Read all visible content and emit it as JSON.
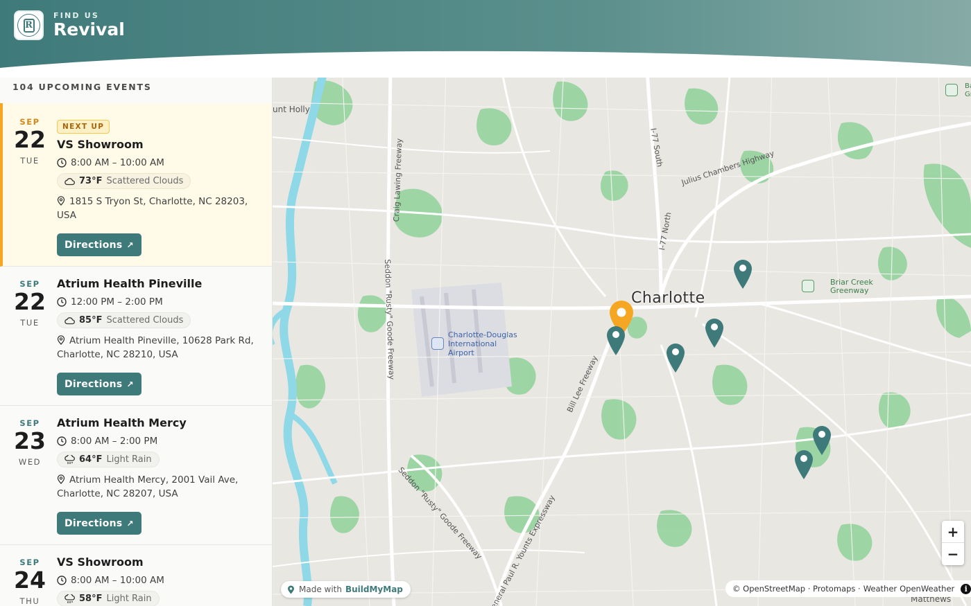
{
  "header": {
    "eyebrow": "FIND US",
    "brand": "Revival",
    "logo_icon": "revival-logo",
    "colors": {
      "primary": "#3f7a7a",
      "accent": "#f5a623"
    }
  },
  "sidebar": {
    "count_label": "104 UPCOMING EVENTS",
    "next_badge": "NEXT UP",
    "directions_label": "Directions",
    "events": [
      {
        "month": "SEP",
        "day": "22",
        "dow": "TUE",
        "title": "VS Showroom",
        "time": "8:00 AM – 10:00 AM",
        "temp": "73°F",
        "condition": "Scattered Clouds",
        "weather_icon": "cloud-icon",
        "address": "1815 S Tryon St, Charlotte, NC 28203, USA",
        "next": true
      },
      {
        "month": "SEP",
        "day": "22",
        "dow": "TUE",
        "title": "Atrium Health Pineville",
        "time": "12:00 PM – 2:00 PM",
        "temp": "85°F",
        "condition": "Scattered Clouds",
        "weather_icon": "cloud-icon",
        "address": "Atrium Health Pineville, 10628 Park Rd, Charlotte, NC 28210, USA",
        "next": false
      },
      {
        "month": "SEP",
        "day": "23",
        "dow": "WED",
        "title": "Atrium Health Mercy",
        "time": "8:00 AM – 2:00 PM",
        "temp": "64°F",
        "condition": "Light Rain",
        "weather_icon": "rain-icon",
        "address": "Atrium Health Mercy, 2001 Vail Ave, Charlotte, NC 28207, USA",
        "next": false
      },
      {
        "month": "SEP",
        "day": "24",
        "dow": "THU",
        "title": "VS Showroom",
        "time": "8:00 AM – 10:00 AM",
        "temp": "58°F",
        "condition": "Light Rain",
        "weather_icon": "rain-icon",
        "address": "",
        "next": false
      }
    ]
  },
  "map": {
    "labels": {
      "city": "Charlotte",
      "mount_holly": "unt Holly",
      "craig_lawing": "Craig Lawing Freeway",
      "i77_south": "I-77 South",
      "i77_north": "I-77 North",
      "julius": "Julius Chambers Highway",
      "seddon1": "Seddon \"Rusty\" Goode Freeway",
      "seddon2": "Seddon \"Rusty\" Goode Freeway",
      "bill_lee": "Bill Lee Freeway",
      "paul_younts": "eneral Paul R. Younts Expressway",
      "airport_line1": "Charlotte-Douglas",
      "airport_line2": "International",
      "airport_line3": "Airport",
      "park_line1": "Briar Creek",
      "park_line2": "Greenway",
      "top_right1": "Ba",
      "top_right2": "Gr",
      "matthews": "Matthews"
    },
    "zoom_in": "+",
    "zoom_out": "−",
    "made_with_prefix": "Made with",
    "made_with_brand": "BuildMyMap",
    "attribution": "© OpenStreetMap · Protomaps · ",
    "attribution_weather_label": "Weather",
    "attribution_weather": "OpenWeather",
    "info_symbol": "i"
  }
}
